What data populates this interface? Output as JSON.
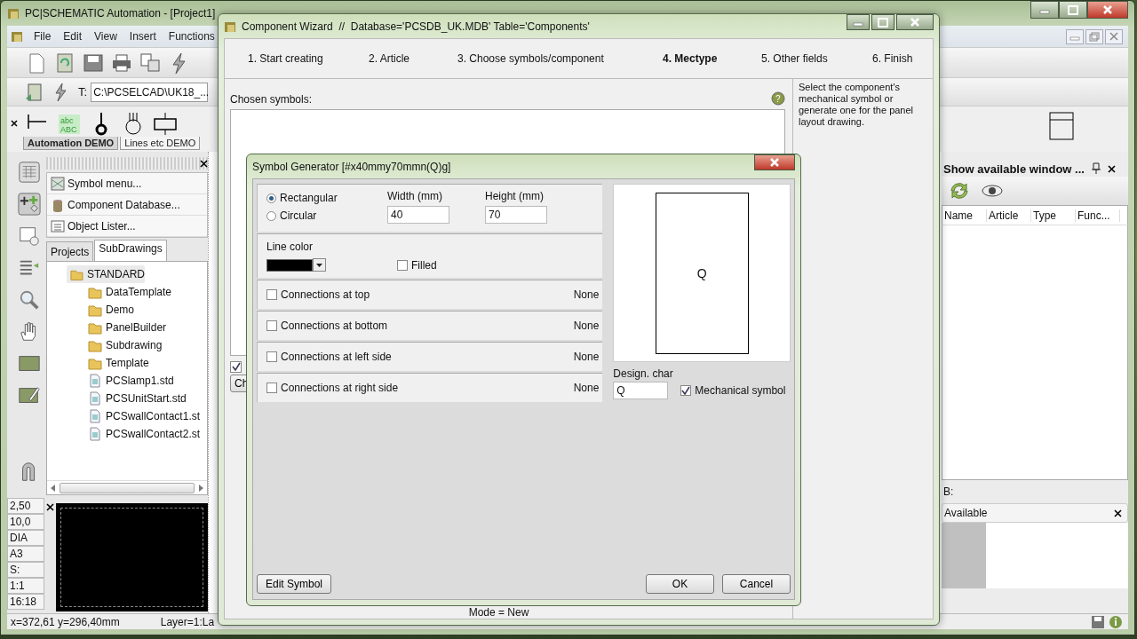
{
  "app": {
    "title": "PC|SCHEMATIC Automation - [Project1]",
    "menu": [
      "File",
      "Edit",
      "View",
      "Insert",
      "Functions"
    ],
    "text_symbol": [
      "abc",
      "ABC"
    ],
    "path_label": "T:",
    "path_field": {
      "value": "C:\\PCSELCAD\\UK18_..."
    },
    "symbol_tabs": [
      {
        "label": "Automation DEMO",
        "selected": true
      },
      {
        "label": "Lines etc DEMO",
        "selected": false
      }
    ],
    "panel_items": [
      "Symbol menu...",
      "Component Database...",
      "Object Lister..."
    ],
    "panel_tabs": [
      {
        "label": "Projects",
        "selected": false
      },
      {
        "label": "SubDrawings",
        "selected": true
      }
    ],
    "tree": [
      {
        "label": "STANDARD",
        "kind": "folder",
        "selected": true,
        "children": [
          {
            "label": "DataTemplate",
            "kind": "folder",
            "selected": false
          },
          {
            "label": "Demo",
            "kind": "folder",
            "selected": false
          },
          {
            "label": "PanelBuilder",
            "kind": "folder",
            "selected": false
          },
          {
            "label": "Subdrawing",
            "kind": "folder",
            "selected": false
          },
          {
            "label": "Template",
            "kind": "folder",
            "selected": false
          },
          {
            "label": "PCSlamp1.std",
            "kind": "file",
            "selected": false
          },
          {
            "label": "PCSUnitStart.std",
            "kind": "file",
            "selected": false
          },
          {
            "label": "PCSwallContact1.st",
            "kind": "file",
            "selected": false
          },
          {
            "label": "PCSwallContact2.st",
            "kind": "file",
            "selected": false
          }
        ]
      }
    ],
    "status_values": [
      "2,50",
      "10,0",
      "DIA",
      "A3",
      "S:",
      "1:1",
      "16:18"
    ],
    "status_bar": {
      "coords": "x=372,61 y=296,40mm",
      "layer": "Layer=1:La"
    }
  },
  "side_panel": {
    "title": "Show available window ...",
    "columns": [
      "Name",
      "Article",
      "Type",
      "Func..."
    ],
    "b_label": "B:",
    "available": "Available"
  },
  "wizard": {
    "title": "Component Wizard  //  Database='PCSDB_UK.MDB' Table='Components'",
    "steps": [
      {
        "label": "1. Start creating",
        "selected": false
      },
      {
        "label": "2. Article",
        "selected": false
      },
      {
        "label": "3. Choose symbols/component",
        "selected": false
      },
      {
        "label": "4. Mectype",
        "selected": true
      },
      {
        "label": "5. Other fields",
        "selected": false
      },
      {
        "label": "6. Finish",
        "selected": false
      }
    ],
    "chosen_label": "Chosen symbols:",
    "help": "?",
    "description": "Select the component's mechanical symbol or generate one for the panel layout drawing.",
    "hidden_checkbox": {
      "checked": true
    },
    "hidden_button": "Ch",
    "mode": "Mode = New"
  },
  "generator": {
    "title": "Symbol Generator [#x40mmy70mmn(Q)g]",
    "shapes": [
      {
        "label": "Rectangular",
        "selected": true
      },
      {
        "label": "Circular",
        "selected": false
      }
    ],
    "width": {
      "label": "Width (mm)",
      "value": "40"
    },
    "height": {
      "label": "Height (mm)",
      "value": "70"
    },
    "line_color": {
      "label": "Line color",
      "color": "#000000"
    },
    "filled": {
      "label": "Filled",
      "checked": false
    },
    "connections": [
      {
        "label": "Connections at top",
        "checked": false,
        "value": "None"
      },
      {
        "label": "Connections at bottom",
        "checked": false,
        "value": "None"
      },
      {
        "label": "Connections at left side",
        "checked": false,
        "value": "None"
      },
      {
        "label": "Connections at right side",
        "checked": false,
        "value": "None"
      }
    ],
    "preview_char": "Q",
    "design_char": {
      "label": "Design. char",
      "value": "Q"
    },
    "mechanical": {
      "label": "Mechanical symbol",
      "checked": true
    },
    "buttons": {
      "edit": "Edit Symbol",
      "ok": "OK",
      "cancel": "Cancel"
    }
  }
}
